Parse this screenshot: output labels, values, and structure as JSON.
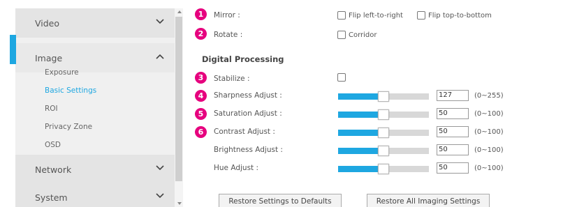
{
  "sidebar": {
    "video": "Video",
    "image": "Image",
    "image_items": [
      "Exposure",
      "Basic Settings",
      "ROI",
      "Privacy Zone",
      "OSD"
    ],
    "network": "Network",
    "system": "System"
  },
  "settings": {
    "mirror_label": "Mirror :",
    "flip_lr": "Flip left-to-right",
    "flip_tb": "Flip top-to-bottom",
    "rotate_label": "Rotate :",
    "corridor": "Corridor",
    "digital_processing": "Digital Processing",
    "stabilize_label": "Stabilize :",
    "sliders": [
      {
        "label": "Sharpness Adjust :",
        "value": "127",
        "range": "(0~255)",
        "fraction": 0.5
      },
      {
        "label": "Saturation Adjust :",
        "value": "50",
        "range": "(0~100)",
        "fraction": 0.5
      },
      {
        "label": "Contrast Adjust :",
        "value": "50",
        "range": "(0~100)",
        "fraction": 0.5
      },
      {
        "label": "Brightness Adjust :",
        "value": "50",
        "range": "(0~100)",
        "fraction": 0.5
      },
      {
        "label": "Hue Adjust :",
        "value": "50",
        "range": "(0~100)",
        "fraction": 0.5
      }
    ]
  },
  "badges": [
    "1",
    "2",
    "3",
    "4",
    "5",
    "6"
  ],
  "buttons": {
    "restore_defaults": "Restore Settings to Defaults",
    "restore_all": "Restore All Imaging Settings"
  },
  "colors": {
    "accent": "#1ea7e1",
    "badge": "#e6007e"
  }
}
